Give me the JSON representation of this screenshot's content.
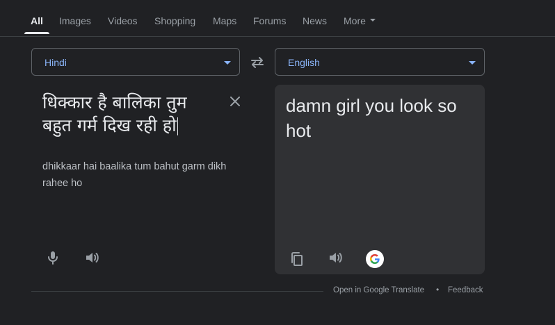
{
  "tabs": [
    {
      "label": "All",
      "active": true
    },
    {
      "label": "Images"
    },
    {
      "label": "Videos"
    },
    {
      "label": "Shopping"
    },
    {
      "label": "Maps"
    },
    {
      "label": "Forums"
    },
    {
      "label": "News"
    },
    {
      "label": "More"
    }
  ],
  "source": {
    "language": "Hindi",
    "text": "धिक्कार है बालिका तुम बहुत गर्म दिख रही हो",
    "transliteration": "dhikkaar hai baalika tum bahut garm dikh rahee ho"
  },
  "target": {
    "language": "English",
    "text": "damn girl you look so hot"
  },
  "footer": {
    "open_link": "Open in Google Translate",
    "separator": "•",
    "feedback": "Feedback"
  },
  "icons": {
    "swap": "swap-icon",
    "clear": "close-icon",
    "mic": "microphone-icon",
    "speaker": "speaker-icon",
    "copy": "copy-icon",
    "google": "google-g-icon"
  },
  "colors": {
    "background": "#202124",
    "panel": "#303134",
    "accent": "#8ab4f8",
    "text": "#e8eaed",
    "muted": "#9aa0a6"
  }
}
